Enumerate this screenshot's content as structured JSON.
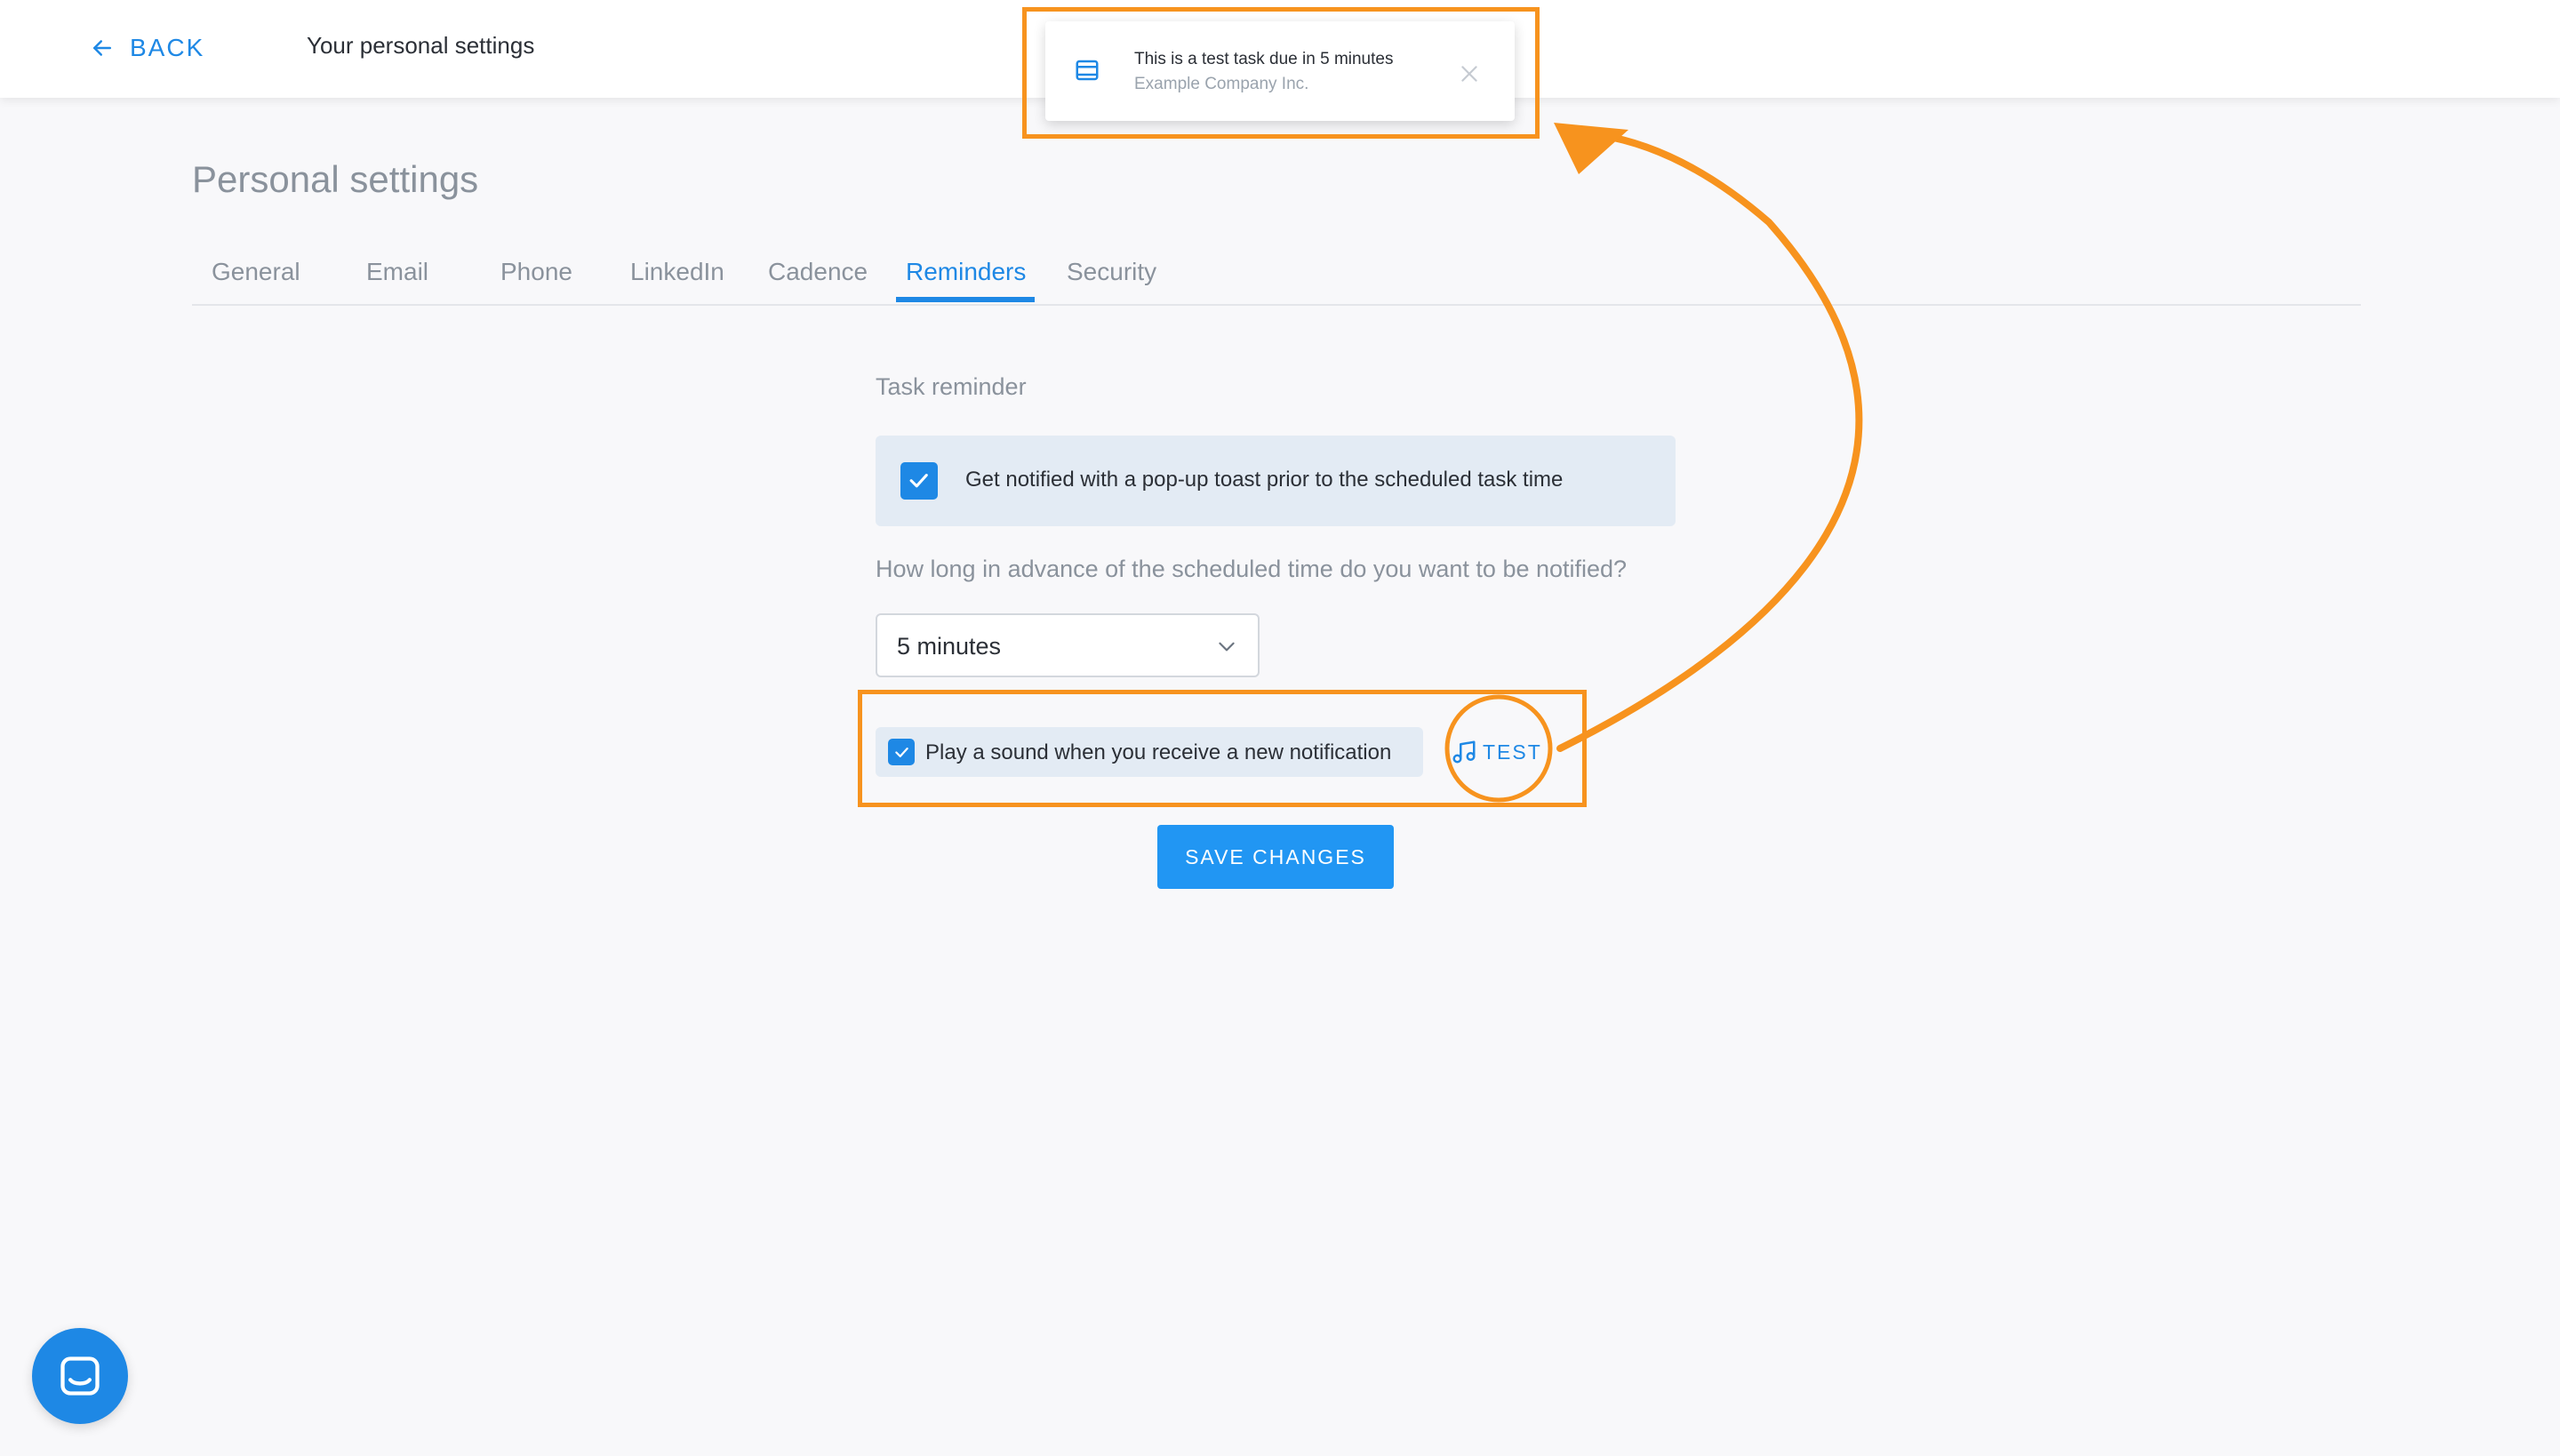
{
  "topbar": {
    "back_label": "BACK",
    "title": "Your personal settings"
  },
  "toast": {
    "title": "This is a test task due in 5 minutes",
    "subtitle": "Example Company Inc."
  },
  "page": {
    "heading": "Personal settings"
  },
  "tabs": [
    {
      "label": "General",
      "active": false
    },
    {
      "label": "Email",
      "active": false
    },
    {
      "label": "Phone",
      "active": false
    },
    {
      "label": "LinkedIn",
      "active": false
    },
    {
      "label": "Cadence",
      "active": false
    },
    {
      "label": "Reminders",
      "active": true
    },
    {
      "label": "Security",
      "active": false
    }
  ],
  "reminders": {
    "section_label": "Task reminder",
    "toast_checkbox_label": "Get notified with a pop-up toast prior to the scheduled task time",
    "toast_checkbox_checked": true,
    "advance_question": "How long in advance of the scheduled time do you want to be notified?",
    "advance_select_value": "5 minutes",
    "sound_checkbox_label": "Play a sound when you receive a new notification",
    "sound_checkbox_checked": true,
    "test_label": "TEST",
    "save_label": "SAVE CHANGES"
  },
  "icons": {
    "back": "arrow-left-icon",
    "toast": "browser-window-icon",
    "close": "close-icon",
    "chevron": "chevron-down-icon",
    "check": "check-icon",
    "music": "music-note-icon",
    "chat": "chat-smile-icon"
  },
  "colors": {
    "accent": "#1e88e5",
    "annotation": "#f7931e",
    "checkbox_bg": "#e3ebf4",
    "save_button": "#2196f3"
  }
}
